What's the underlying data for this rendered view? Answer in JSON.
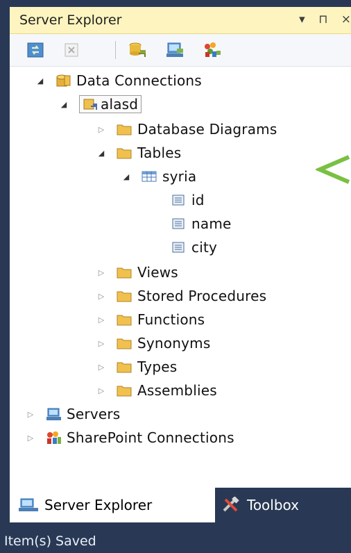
{
  "window": {
    "title": "Server Explorer",
    "controls": [
      "▾",
      "⊓",
      "×"
    ]
  },
  "toolbar": {
    "buttons": [
      "refresh",
      "stop-refresh",
      "connect-to-database",
      "connect-to-server",
      "connect-to-sharepoint"
    ]
  },
  "tree": {
    "data_connections": "Data Connections",
    "connection": "alasd",
    "database_diagrams": "Database Diagrams",
    "tables": "Tables",
    "table": "syria",
    "columns": [
      "id",
      "name",
      "city"
    ],
    "views": "Views",
    "stored_procedures": "Stored Procedures",
    "functions": "Functions",
    "synonyms": "Synonyms",
    "types": "Types",
    "assemblies": "Assemblies",
    "servers": "Servers",
    "sharepoint": "SharePoint Connections"
  },
  "tabs": {
    "server_explorer": "Server Explorer",
    "toolbox": "Toolbox"
  },
  "status": {
    "text": "Item(s) Saved"
  },
  "colors": {
    "frame": "#293955",
    "titlebar": "#fdf4bf",
    "folder": "#e8b84a",
    "arrow": "#7ac043"
  }
}
